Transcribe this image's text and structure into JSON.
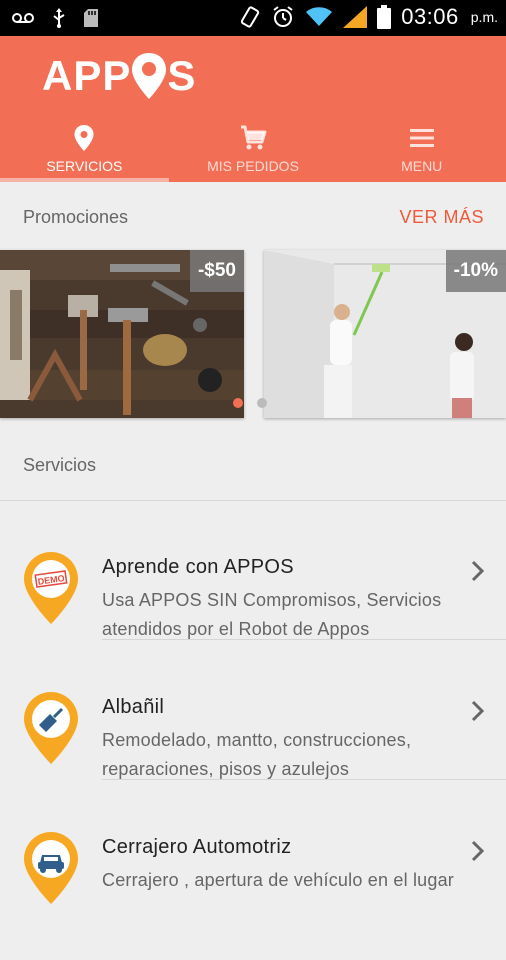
{
  "status_bar": {
    "time": "03:06",
    "ampm": "p.m.",
    "icons": [
      "voicemail-icon",
      "usb-icon",
      "sd-card-icon",
      "rotate-icon",
      "alarm-icon",
      "wifi-icon",
      "signal-icon",
      "battery-icon"
    ]
  },
  "app": {
    "logo_left": "APP",
    "logo_right": "S",
    "brand_color": "#f26f55"
  },
  "tabs": [
    {
      "label": "SERVICIOS",
      "icon": "location-pin-icon",
      "active": true
    },
    {
      "label": "MIS PEDIDOS",
      "icon": "cart-icon",
      "active": false
    },
    {
      "label": "MENU",
      "icon": "hamburger-icon",
      "active": false
    }
  ],
  "promociones": {
    "title": "Promociones",
    "ver_mas": "VER MÁS",
    "cards": [
      {
        "badge": "-$50",
        "image": "tools-on-wood-photo"
      },
      {
        "badge": "-10%",
        "image": "painter-and-woman-photo"
      }
    ],
    "active_dot": 0
  },
  "servicios": {
    "title": "Servicios",
    "items": [
      {
        "title": "Aprende con APPOS",
        "desc": "Usa APPOS SIN Compromisos, Servicios atendidos por el Robot de Appos",
        "icon": "demo-stamp-icon"
      },
      {
        "title": "Albañil",
        "desc": "Remodelado, mantto, construcciones, reparaciones, pisos y azulejos",
        "icon": "trowel-icon"
      },
      {
        "title": "Cerrajero Automotriz",
        "desc": "Cerrajero , apertura de vehículo en el lugar",
        "icon": "car-key-icon"
      }
    ]
  }
}
